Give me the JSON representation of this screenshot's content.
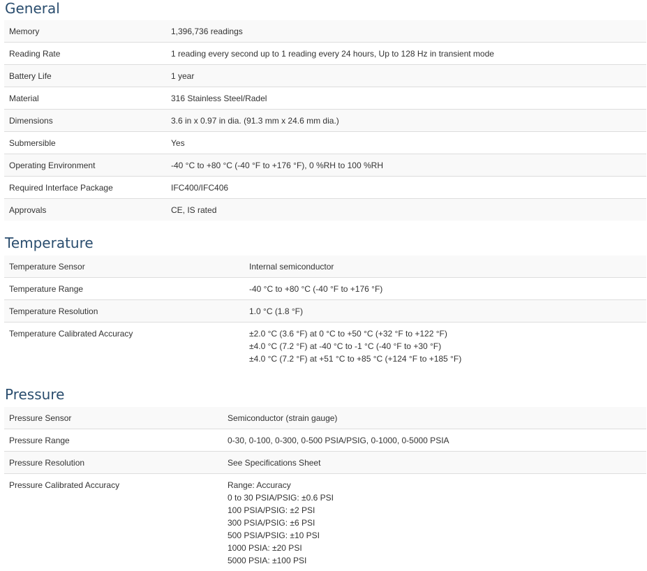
{
  "general": {
    "title": "General",
    "rows": [
      {
        "label": "Memory",
        "value": "1,396,736 readings"
      },
      {
        "label": "Reading Rate",
        "value": "1 reading every second up to 1 reading every 24 hours, Up to 128 Hz in transient mode"
      },
      {
        "label": "Battery Life",
        "value": "1 year"
      },
      {
        "label": "Material",
        "value": "316 Stainless Steel/Radel"
      },
      {
        "label": "Dimensions",
        "value": "3.6 in x 0.97 in dia. (91.3 mm x 24.6 mm dia.)"
      },
      {
        "label": "Submersible",
        "value": "Yes"
      },
      {
        "label": "Operating Environment",
        "value": "-40 °C to +80 °C (-40 °F to +176 °F), 0 %RH to 100 %RH"
      },
      {
        "label": "Required Interface Package",
        "value": "IFC400/IFC406"
      },
      {
        "label": "Approvals",
        "value": "CE, IS rated"
      }
    ]
  },
  "temperature": {
    "title": "Temperature",
    "rows": [
      {
        "label": "Temperature Sensor",
        "value": "Internal semiconductor"
      },
      {
        "label": "Temperature Range",
        "value": "-40 °C to +80 °C (-40 °F to +176 °F)"
      },
      {
        "label": "Temperature Resolution",
        "value": "1.0 °C (1.8 °F)"
      },
      {
        "label": "Temperature Calibrated Accuracy",
        "lines": [
          "±2.0 °C (3.6 °F) at 0 °C to +50 °C (+32 °F to +122 °F)",
          "±4.0 °C (7.2 °F) at -40 °C to -1 °C (-40 °F to +30 °F)",
          "±4.0 °C (7.2 °F) at +51 °C to +85 °C (+124 °F to +185 °F)"
        ]
      }
    ]
  },
  "pressure": {
    "title": "Pressure",
    "rows": [
      {
        "label": "Pressure Sensor",
        "value": "Semiconductor (strain gauge)"
      },
      {
        "label": "Pressure Range",
        "value": "0-30, 0-100, 0-300, 0-500 PSIA/PSIG, 0-1000, 0-5000 PSIA"
      },
      {
        "label": "Pressure Resolution",
        "value": "See Specifications Sheet"
      },
      {
        "label": "Pressure Calibrated Accuracy",
        "lines": [
          "Range: Accuracy",
          "0 to 30 PSIA/PSIG: ±0.6 PSI",
          "100 PSIA/PSIG: ±2 PSI",
          "300 PSIA/PSIG: ±6 PSI",
          "500 PSIA/PSIG: ±10 PSI",
          "1000 PSIA: ±20 PSI",
          "5000 PSIA: ±100 PSI"
        ]
      }
    ]
  }
}
